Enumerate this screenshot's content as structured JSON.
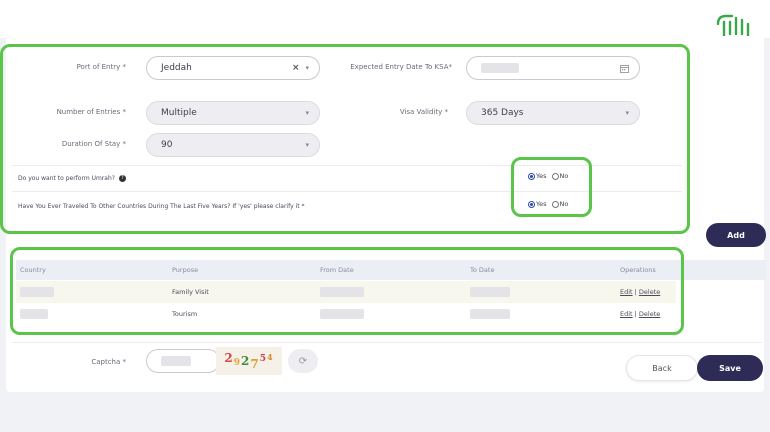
{
  "form": {
    "port_of_entry": {
      "label": "Port of Entry *",
      "value": "Jeddah"
    },
    "expected_entry_date": {
      "label": "Expected Entry Date To KSA*",
      "value": ""
    },
    "number_of_entries": {
      "label": "Number of Entries *",
      "value": "Multiple"
    },
    "visa_validity": {
      "label": "Visa Validity *",
      "value": "365 Days"
    },
    "duration_of_stay": {
      "label": "Duration Of Stay *",
      "value": "90"
    },
    "umrah_question": {
      "label": "Do you want to perform Umrah?",
      "yes": "Yes",
      "no": "No",
      "selected": "Yes"
    },
    "travel_question": {
      "label": "Have You Ever Traveled To Other Countries During The Last Five Years? If 'yes' please clarify it *",
      "yes": "Yes",
      "no": "No",
      "selected": "Yes"
    }
  },
  "add_button": "Add",
  "table": {
    "headers": [
      "Country",
      "Purpose",
      "From Date",
      "To Date",
      "Operations"
    ],
    "rows": [
      {
        "purpose": "Family Visit",
        "edit": "Edit",
        "delete": "Delete"
      },
      {
        "purpose": "Tourism",
        "edit": "Edit",
        "delete": "Delete"
      }
    ]
  },
  "captcha": {
    "label": "Captcha *",
    "code": [
      "2",
      "9",
      "2",
      "7",
      "5",
      "4"
    ]
  },
  "buttons": {
    "back": "Back",
    "save": "Save"
  },
  "icons": {
    "clear": "close-icon",
    "dropdown": "chevron-down-icon",
    "calendar": "calendar-icon",
    "help": "help-icon",
    "refresh": "refresh-icon",
    "logo": "saudi-logo-icon"
  },
  "colors": {
    "highlight": "#5bc54a",
    "primary_button": "#2e2b57",
    "logo": "#3aa84a"
  }
}
